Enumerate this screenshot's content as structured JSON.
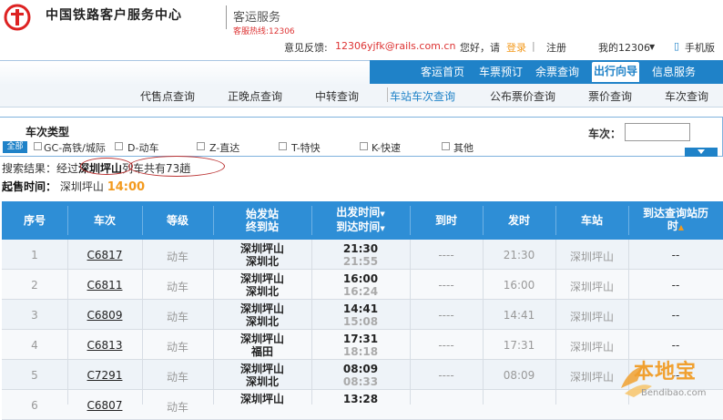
{
  "header": {
    "brand": "中国铁路客户服务中心",
    "sub": "客运服务",
    "hotline": "客服热线:12306"
  },
  "userbar": {
    "feedback_label": "意见反馈:",
    "feedback_email": "12306yjfk@rails.com.cn",
    "greeting": "您好，请",
    "login": "登录",
    "register": "注册",
    "my12306": "我的12306",
    "mobile": "手机版"
  },
  "nav1": [
    "客运首页",
    "车票预订",
    "余票查询",
    "出行向导",
    "信息服务"
  ],
  "nav2": [
    "代售点查询",
    "正晚点查询",
    "中转查询",
    "车站车次查询",
    "公布票价查询",
    "票价查询",
    "车次查询"
  ],
  "filter": {
    "title": "车次类型",
    "all": "全部",
    "options": [
      "GC-高铁/城际",
      "D-动车",
      "Z-直达",
      "T-特快",
      "K-快速",
      "其他"
    ],
    "train_no_label": "车次："
  },
  "result": {
    "prefix": "搜索结果：经过",
    "station": "深圳坪山",
    "suffix": "列车共有73趟"
  },
  "sale": {
    "label": "起售时间：",
    "station": "深圳坪山",
    "time": "14:00"
  },
  "table": {
    "headers": {
      "no": "序号",
      "train": "车次",
      "grade": "等级",
      "from": "始发站",
      "to": "终到站",
      "dep": "出发时间",
      "arr": "到达时间",
      "arrive": "到时",
      "depart": "发时",
      "station": "车站",
      "hist1": "到达查询站历",
      "hist2": "时"
    },
    "rows": [
      {
        "no": "1",
        "train": "C6817",
        "grade": "动车",
        "from": "深圳坪山",
        "to": "深圳北",
        "dep": "21:30",
        "arr": "21:55",
        "arrive": "----",
        "depart": "21:30",
        "station": "深圳坪山",
        "hist": "--"
      },
      {
        "no": "2",
        "train": "C6811",
        "grade": "动车",
        "from": "深圳坪山",
        "to": "深圳北",
        "dep": "16:00",
        "arr": "16:24",
        "arrive": "----",
        "depart": "16:00",
        "station": "深圳坪山",
        "hist": "--"
      },
      {
        "no": "3",
        "train": "C6809",
        "grade": "动车",
        "from": "深圳坪山",
        "to": "深圳北",
        "dep": "14:41",
        "arr": "15:08",
        "arrive": "----",
        "depart": "14:41",
        "station": "深圳坪山",
        "hist": "--"
      },
      {
        "no": "4",
        "train": "C6813",
        "grade": "动车",
        "from": "深圳坪山",
        "to": "福田",
        "dep": "17:31",
        "arr": "18:18",
        "arrive": "----",
        "depart": "17:31",
        "station": "深圳坪山",
        "hist": "--"
      },
      {
        "no": "5",
        "train": "C7291",
        "grade": "动车",
        "from": "深圳坪山",
        "to": "深圳北",
        "dep": "08:09",
        "arr": "08:33",
        "arrive": "----",
        "depart": "08:09",
        "station": "深圳坪山",
        "hist": "--"
      },
      {
        "no": "6",
        "train": "C6807",
        "grade": "动车",
        "from": "深圳坪山",
        "to": "",
        "dep": "13:28",
        "arr": "",
        "arrive": "",
        "depart": "",
        "station": "",
        "hist": ""
      }
    ]
  },
  "watermark": {
    "text": "本地宝",
    "sub": "Bendibao.com"
  },
  "colors": {
    "header_blue": "#2e8ed6",
    "nav_blue": "#1f82c8",
    "orange": "#f39a1e",
    "oval_red": "#b33"
  }
}
